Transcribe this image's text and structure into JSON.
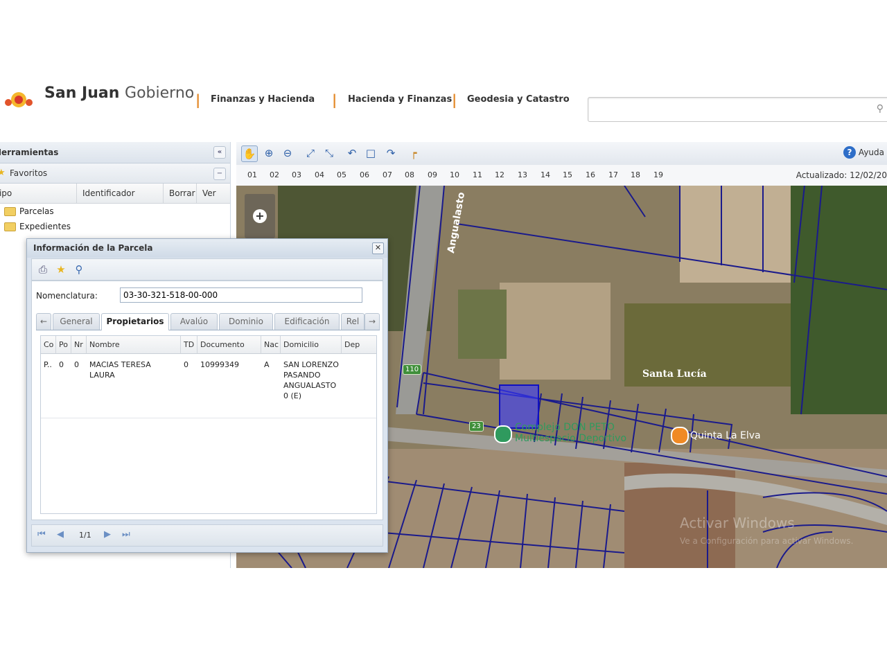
{
  "header": {
    "brand_bold": "San Juan",
    "brand_light": "Gobierno",
    "links": [
      "Finanzas y Hacienda",
      "Hacienda y Finanzas",
      "Geodesia y Catastro"
    ],
    "search": {
      "value": "",
      "placeholder": ""
    },
    "colors": {
      "separator": "#e38a2a"
    }
  },
  "left_panel": {
    "title": "Herramientas",
    "favorites_title": "Favoritos",
    "columns": [
      "Tipo",
      "Identificador",
      "Borrar",
      "Ver"
    ],
    "tree": [
      {
        "label": "Parcelas",
        "icon": "folder-icon"
      },
      {
        "label": "Expedientes",
        "icon": "folder-icon"
      }
    ]
  },
  "map": {
    "toolbar_tools": [
      "pan-hand-icon",
      "zoom-in-icon",
      "zoom-out-icon",
      "full-extent-icon",
      "fit-extent-icon",
      "undo-icon",
      "select-box-icon",
      "redo-icon",
      "measure-icon"
    ],
    "help_label": "Ayuda",
    "scale_levels": [
      "01",
      "02",
      "03",
      "04",
      "05",
      "06",
      "07",
      "08",
      "09",
      "10",
      "11",
      "12",
      "13",
      "14",
      "15",
      "16",
      "17",
      "18",
      "19"
    ],
    "updated_label": "Actualizado: 12/02/20",
    "labels": {
      "road": "Angualasto",
      "place": "Santa Lucía",
      "poi_sports": "Complejo DON PETO",
      "poi_sports_sub": "Multiespacio Deportivo",
      "poi_farm": "Quinta La Elva",
      "route_110": "110",
      "route_23": "23"
    },
    "colors": {
      "parcel_lines": "#1a1a8c",
      "selected_parcel": "#3b3bff",
      "route_badge": "#3f8f3a",
      "pin_green": "#2f9a5e",
      "pin_orange": "#f08a24"
    }
  },
  "dialog": {
    "title": "Información de la Parcela",
    "toolbar": [
      "print-icon",
      "favorite-star-icon",
      "search-magnifier-icon"
    ],
    "nomenclatura_label": "Nomenclatura:",
    "nomenclatura_value": "03-30-321-518-00-000",
    "tabs": [
      "General",
      "Propietarios",
      "Avalúo",
      "Dominio",
      "Edificación",
      "Rel"
    ],
    "active_tab": "Propietarios",
    "owners": {
      "columns": [
        "Co",
        "Po",
        "Nr",
        "Nombre",
        "TD",
        "Documento",
        "Nac",
        "Domicilio",
        "Dep"
      ],
      "rows": [
        {
          "co": "P..",
          "po": "0",
          "nr": "0",
          "nombre": "MACIAS TERESA LAURA",
          "td": "0",
          "documento": "10999349",
          "nac": "A",
          "domicilio": "SAN LORENZO PASANDO ANGUALASTO 0 (E)",
          "dep": ""
        }
      ]
    },
    "pager": {
      "page_info": "1/1"
    }
  },
  "watermark": {
    "line1": "Activar Windows",
    "line2": "Ve a Configuración para activar Windows."
  }
}
